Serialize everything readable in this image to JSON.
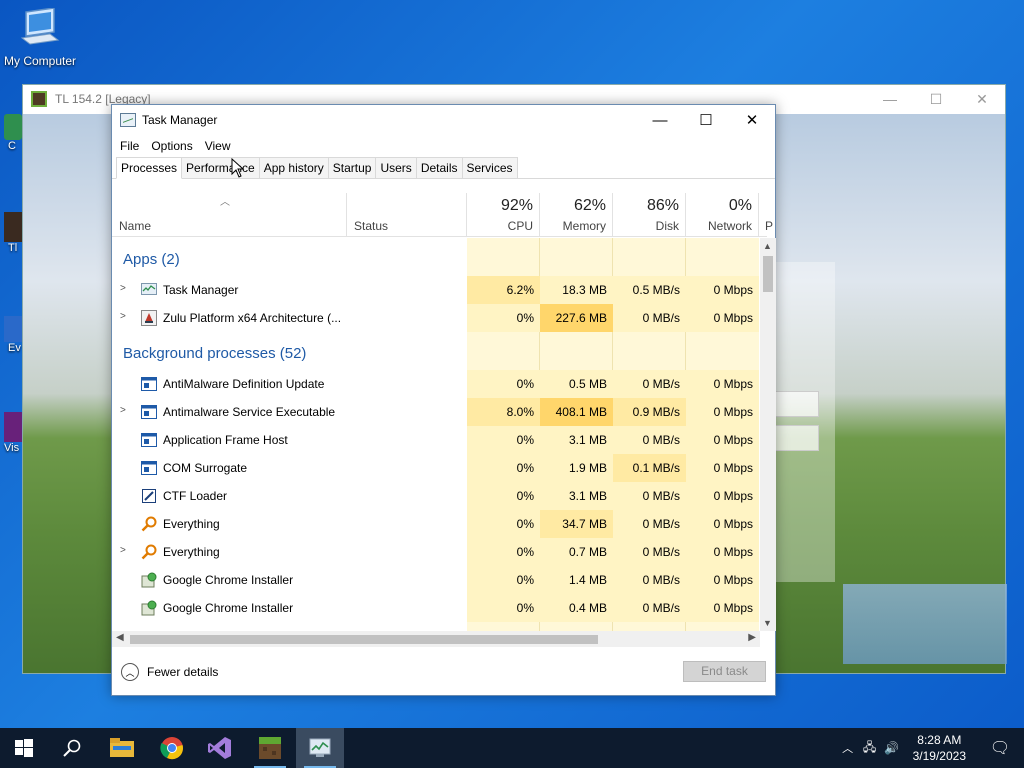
{
  "desktop": {
    "icons": [
      {
        "label": "My Computer",
        "icon": "computer-icon"
      }
    ],
    "partial_labels": [
      "C",
      "Tl",
      "Ev",
      "Vis"
    ]
  },
  "background_window": {
    "title": "TL 154.2 [Legacy]",
    "controls": [
      "minimize",
      "maximize",
      "close"
    ]
  },
  "task_manager": {
    "title": "Task Manager",
    "menu": [
      "File",
      "Options",
      "View"
    ],
    "tabs": [
      {
        "label": "Processes",
        "active": true
      },
      {
        "label": "Performance",
        "active": false
      },
      {
        "label": "App history",
        "active": false
      },
      {
        "label": "Startup",
        "active": false
      },
      {
        "label": "Users",
        "active": false
      },
      {
        "label": "Details",
        "active": false
      },
      {
        "label": "Services",
        "active": false
      }
    ],
    "columns": {
      "name": "Name",
      "status": "Status",
      "cpu": {
        "pct": "92%",
        "label": "CPU"
      },
      "memory": {
        "pct": "62%",
        "label": "Memory"
      },
      "disk": {
        "pct": "86%",
        "label": "Disk"
      },
      "network": {
        "pct": "0%",
        "label": "Network"
      },
      "next": "P"
    },
    "groups": {
      "apps": "Apps (2)",
      "background": "Background processes (52)"
    },
    "apps": [
      {
        "name": "Task Manager",
        "icon": "task-manager-icon",
        "expandable": true,
        "cpu": "6.2%",
        "memory": "18.3 MB",
        "disk": "0.5 MB/s",
        "network": "0 Mbps",
        "heat": {
          "cpu": 2,
          "memory": 1,
          "disk": 1
        }
      },
      {
        "name": "Zulu Platform x64 Architecture (...",
        "icon": "java-icon",
        "expandable": true,
        "cpu": "0%",
        "memory": "227.6 MB",
        "disk": "0 MB/s",
        "network": "0 Mbps",
        "heat": {
          "cpu": 1,
          "memory": 3,
          "disk": 1
        }
      }
    ],
    "background": [
      {
        "name": "AntiMalware Definition Update",
        "icon": "app-window-icon",
        "expandable": false,
        "cpu": "0%",
        "memory": "0.5 MB",
        "disk": "0 MB/s",
        "network": "0 Mbps",
        "heat": {
          "cpu": 1,
          "memory": 1,
          "disk": 1
        }
      },
      {
        "name": "Antimalware Service Executable",
        "icon": "app-window-icon",
        "expandable": true,
        "cpu": "8.0%",
        "memory": "408.1 MB",
        "disk": "0.9 MB/s",
        "network": "0 Mbps",
        "heat": {
          "cpu": 2,
          "memory": 3,
          "disk": 2
        }
      },
      {
        "name": "Application Frame Host",
        "icon": "app-window-icon",
        "expandable": false,
        "cpu": "0%",
        "memory": "3.1 MB",
        "disk": "0 MB/s",
        "network": "0 Mbps",
        "heat": {
          "cpu": 1,
          "memory": 1,
          "disk": 1
        }
      },
      {
        "name": "COM Surrogate",
        "icon": "app-window-icon",
        "expandable": false,
        "cpu": "0%",
        "memory": "1.9 MB",
        "disk": "0.1 MB/s",
        "network": "0 Mbps",
        "heat": {
          "cpu": 1,
          "memory": 1,
          "disk": 2
        }
      },
      {
        "name": "CTF Loader",
        "icon": "ctf-loader-icon",
        "expandable": false,
        "cpu": "0%",
        "memory": "3.1 MB",
        "disk": "0 MB/s",
        "network": "0 Mbps",
        "heat": {
          "cpu": 1,
          "memory": 1,
          "disk": 1
        }
      },
      {
        "name": "Everything",
        "icon": "magnifier-icon",
        "expandable": false,
        "cpu": "0%",
        "memory": "34.7 MB",
        "disk": "0 MB/s",
        "network": "0 Mbps",
        "heat": {
          "cpu": 1,
          "memory": 2,
          "disk": 1
        }
      },
      {
        "name": "Everything",
        "icon": "magnifier-icon",
        "expandable": true,
        "cpu": "0%",
        "memory": "0.7 MB",
        "disk": "0 MB/s",
        "network": "0 Mbps",
        "heat": {
          "cpu": 1,
          "memory": 1,
          "disk": 1
        }
      },
      {
        "name": "Google Chrome Installer",
        "icon": "installer-icon",
        "expandable": false,
        "cpu": "0%",
        "memory": "1.4 MB",
        "disk": "0 MB/s",
        "network": "0 Mbps",
        "heat": {
          "cpu": 1,
          "memory": 1,
          "disk": 1
        }
      },
      {
        "name": "Google Chrome Installer",
        "icon": "installer-icon",
        "expandable": false,
        "cpu": "0%",
        "memory": "0.4 MB",
        "disk": "0 MB/s",
        "network": "0 Mbps",
        "heat": {
          "cpu": 1,
          "memory": 1,
          "disk": 1
        }
      }
    ],
    "footer": {
      "fewer_details": "Fewer details",
      "end_task": "End task"
    }
  },
  "taskbar": {
    "apps": [
      "start-icon",
      "search-icon",
      "file-explorer-icon",
      "chrome-icon",
      "visual-studio-icon",
      "minecraft-launcher-icon",
      "task-manager-icon"
    ],
    "clock": {
      "time": "8:28 AM",
      "date": "3/19/2023"
    }
  },
  "colors": {
    "heat1": "#fff4c4",
    "heat2": "#ffeaa3",
    "heat3": "#ffd66b",
    "group_text": "#1f5aa6",
    "accent": "#0078d7"
  }
}
